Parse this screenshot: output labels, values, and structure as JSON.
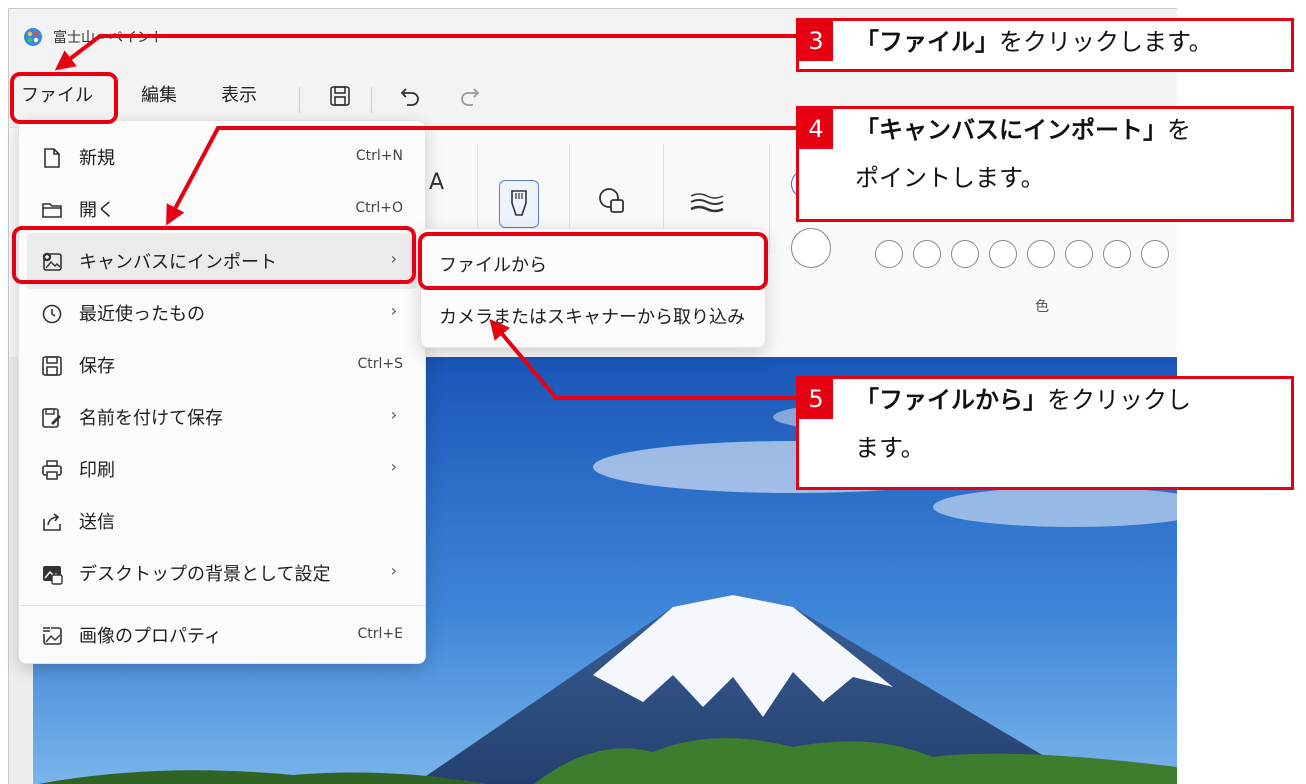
{
  "window": {
    "title": "富士山 - ペイント"
  },
  "menubar": {
    "file": "ファイル",
    "edit": "編集",
    "view": "表示"
  },
  "ribbon": {
    "text_tool": "A",
    "colors_label": "色"
  },
  "file_menu": {
    "items": [
      {
        "label": "新規",
        "shortcut": "Ctrl+N",
        "icon": "new-document-icon"
      },
      {
        "label": "開く",
        "shortcut": "Ctrl+O",
        "icon": "folder-icon"
      },
      {
        "label": "キャンバスにインポート",
        "shortcut": "›",
        "icon": "import-image-icon"
      },
      {
        "label": "最近使ったもの",
        "shortcut": "›",
        "icon": "clock-icon"
      },
      {
        "label": "保存",
        "shortcut": "Ctrl+S",
        "icon": "save-icon"
      },
      {
        "label": "名前を付けて保存",
        "shortcut": "›",
        "icon": "save-as-icon"
      },
      {
        "label": "印刷",
        "shortcut": "›",
        "icon": "printer-icon"
      },
      {
        "label": "送信",
        "shortcut": "",
        "icon": "share-icon"
      },
      {
        "label": "デスクトップの背景として設定",
        "shortcut": "›",
        "icon": "desktop-background-icon"
      },
      {
        "label": "画像のプロパティ",
        "shortcut": "Ctrl+E",
        "icon": "image-properties-icon"
      }
    ]
  },
  "import_submenu": {
    "items": [
      {
        "label": "ファイルから"
      },
      {
        "label": "カメラまたはスキャナーから取り込み"
      }
    ]
  },
  "callouts": {
    "step3": {
      "num": "3",
      "bold": "「ファイル」",
      "rest": "をクリックします。"
    },
    "step4": {
      "num": "4",
      "bold": "「キャンバスにインポート」",
      "rest": "を",
      "line2": "ポイントします。"
    },
    "step5": {
      "num": "5",
      "bold": "「ファイルから」",
      "rest": "をクリックし",
      "line2": "ます。"
    }
  },
  "colors": {
    "accent_red": "#e60012",
    "sky_top": "#1f5fbf",
    "sky_bottom": "#6aa9e8"
  }
}
